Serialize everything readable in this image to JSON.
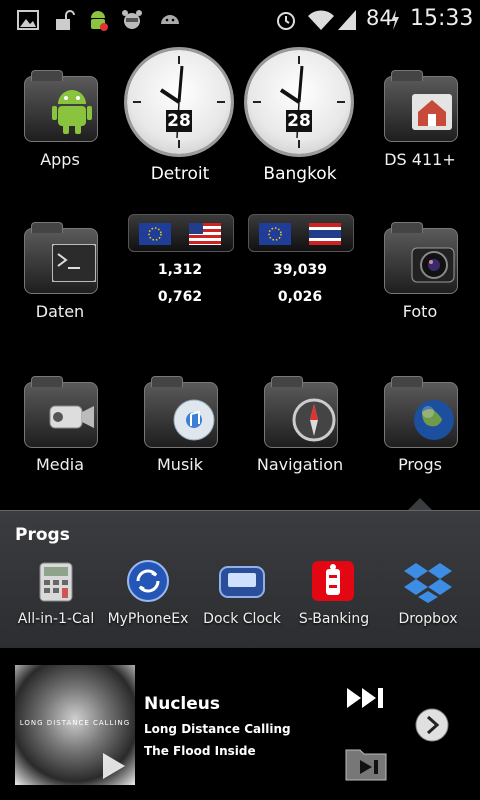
{
  "status_bar": {
    "battery": "84",
    "time": "15:33",
    "icons": [
      "image-icon",
      "unlock-icon",
      "android-icon",
      "raccoon-icon",
      "android-icon",
      "alarm-icon",
      "wifi-icon",
      "signal-icon",
      "charging-icon"
    ]
  },
  "home": {
    "apps_label": "Apps",
    "ds_label": "DS 411+",
    "daten_label": "Daten",
    "foto_label": "Foto",
    "media_label": "Media",
    "musik_label": "Musik",
    "navigation_label": "Navigation",
    "progs_label": "Progs",
    "clocks": [
      {
        "city": "Detroit",
        "date": "28"
      },
      {
        "city": "Bangkok",
        "date": "28"
      }
    ],
    "currency": [
      {
        "rate1": "1,312",
        "rate2": "0,762"
      },
      {
        "rate1": "39,039",
        "rate2": "0,026"
      }
    ]
  },
  "folder_panel": {
    "title": "Progs",
    "apps": [
      {
        "label": "All-in-1-Cal",
        "icon": "calculator-icon"
      },
      {
        "label": "MyPhoneEx",
        "icon": "sync-icon"
      },
      {
        "label": "Dock Clock",
        "icon": "dock-clock-icon"
      },
      {
        "label": "S-Banking",
        "icon": "sparkasse-icon"
      },
      {
        "label": "Dropbox",
        "icon": "dropbox-icon"
      }
    ]
  },
  "music": {
    "title": "Nucleus",
    "artist": "Long Distance Calling",
    "track": "The Flood Inside",
    "album_text": "LONG DISTANCE CALLING"
  },
  "colors": {
    "panel": "#3b3c40",
    "sparkasse_red": "#e30613",
    "android_green": "#8ac43f"
  }
}
